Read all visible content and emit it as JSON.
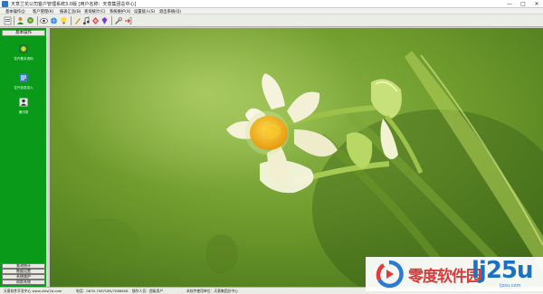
{
  "window": {
    "title": "天意兰花公司客户管理系统3.0版  [用户名称：天意集团总中心]",
    "min_icon": "minimize-icon",
    "max_icon": "maximize-icon",
    "close_icon": "close-icon"
  },
  "menu": [
    {
      "label": "基本操作(J)"
    },
    {
      "label": "客户管理(K)"
    },
    {
      "label": "报表汇总(B)"
    },
    {
      "label": "查询统计(C)"
    },
    {
      "label": "系统维护(X)"
    },
    {
      "label": "设置接入(S)"
    },
    {
      "label": "退出系统(Q)"
    }
  ],
  "toolbar": {
    "icons": [
      "new-record-icon",
      "customer-icon",
      "flower-icon",
      "view-icon",
      "globe-icon",
      "lightbulb-icon",
      "pen-icon",
      "music-icon",
      "colorful-icon",
      "gem-icon",
      "tools-icon",
      "exit-icon"
    ]
  },
  "sidebar": {
    "header": "基本操作",
    "items": [
      {
        "label": "花卉基本资料",
        "icon": "flower-data-icon"
      },
      {
        "label": "花卉信息录入",
        "icon": "data-entry-icon"
      },
      {
        "label": "通讯录",
        "icon": "contacts-icon"
      }
    ],
    "bottom_buttons": [
      {
        "label": "查询统计"
      },
      {
        "label": "数据设置"
      },
      {
        "label": "系统维护"
      },
      {
        "label": "帮助系统"
      }
    ]
  },
  "status": {
    "company": "天意软件开发中心 www.zhisi2b.com",
    "phone": "电话：0635-7087085/7086658",
    "operator": "操作人员：超级用户",
    "unit": "本软件使用单位：天意集团总中心"
  },
  "watermark": {
    "cn_text": "零度软件园",
    "en_text": "lj25u",
    "url": "ljzsu.com"
  },
  "colors": {
    "sidebar_green": "#0a9a1a",
    "content_bg": "#6e9a2c",
    "flower_white": "#f6f3dc",
    "flower_yellow": "#f2b11c"
  }
}
